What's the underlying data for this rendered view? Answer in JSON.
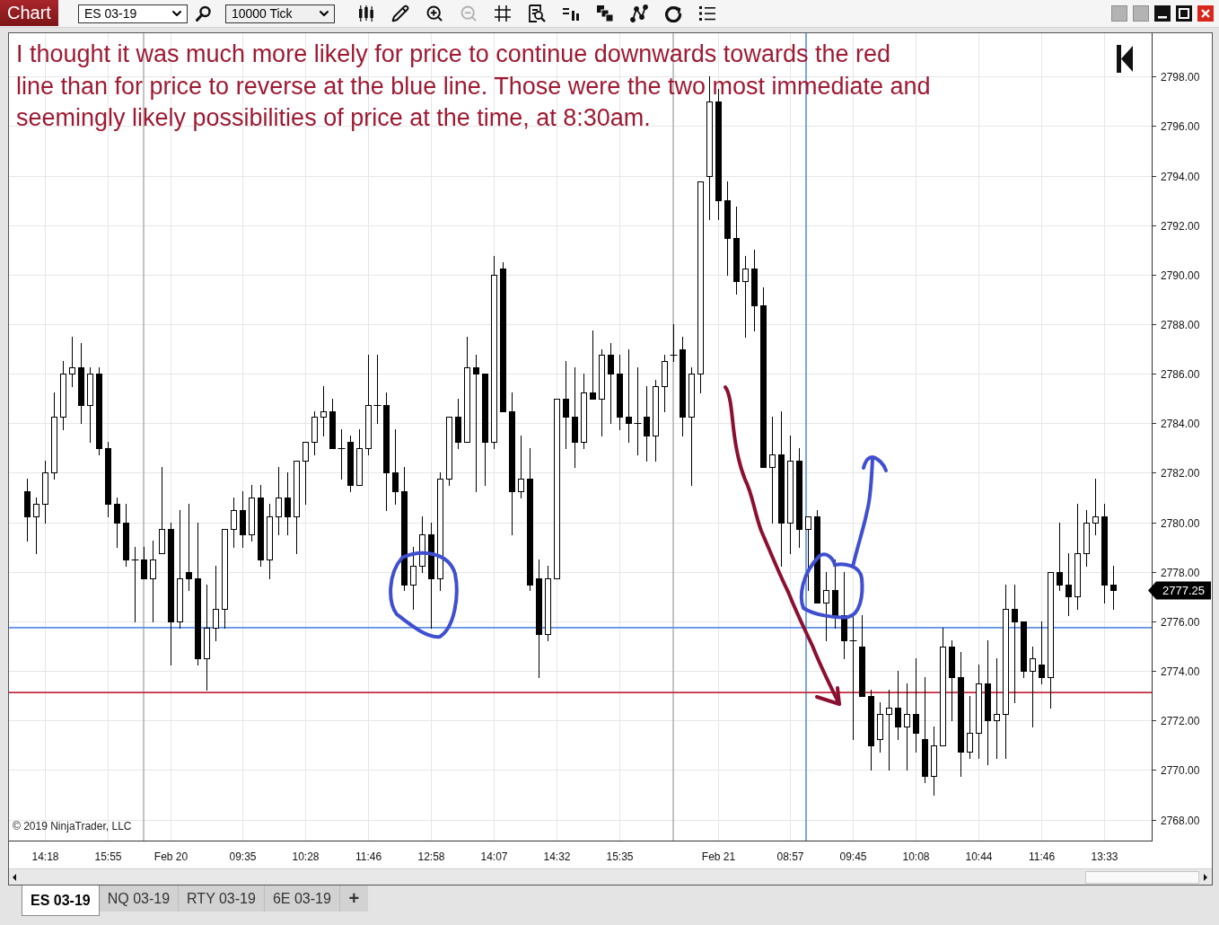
{
  "toolbar": {
    "title": "Chart",
    "instrument": "ES 03-19",
    "interval": "10000 Tick",
    "tools": [
      {
        "kind": "candles",
        "disabled": false
      },
      {
        "kind": "pencil",
        "disabled": false
      },
      {
        "kind": "zoomin",
        "disabled": false
      },
      {
        "kind": "zoomout",
        "disabled": true
      },
      {
        "kind": "crosshair",
        "disabled": false
      },
      {
        "kind": "databox",
        "disabled": false
      },
      {
        "kind": "strategy",
        "disabled": false
      },
      {
        "kind": "layers",
        "disabled": false
      },
      {
        "kind": "drawing",
        "disabled": false
      },
      {
        "kind": "reload",
        "disabled": false
      },
      {
        "kind": "list",
        "disabled": false
      }
    ]
  },
  "chart": {
    "chart_data": [
      {
        "type": "candlestick",
        "categories": [
          null,
          null,
          "14:18",
          null,
          null,
          null,
          null,
          null,
          null,
          "15:55",
          null,
          null,
          null,
          null,
          null,
          null,
          "Feb 20",
          null,
          null,
          null,
          null,
          null,
          null,
          null,
          "09:35",
          null,
          null,
          null,
          null,
          null,
          null,
          "10:28",
          null,
          null,
          null,
          null,
          null,
          null,
          "11:46",
          null,
          null,
          null,
          null,
          null,
          null,
          "12:58",
          null,
          null,
          null,
          null,
          null,
          null,
          "14:07",
          null,
          null,
          null,
          null,
          null,
          null,
          "14:32",
          null,
          null,
          null,
          null,
          null,
          null,
          "15:35",
          null,
          null,
          null,
          null,
          null,
          null,
          null,
          null,
          null,
          null,
          "Feb 21",
          null,
          null,
          null,
          null,
          null,
          null,
          null,
          "08:57",
          null,
          null,
          null,
          null,
          null,
          null,
          "09:45",
          null,
          null,
          null,
          null,
          null,
          null,
          "10:08",
          null,
          null,
          null,
          null,
          null,
          null,
          "10:44",
          null,
          null,
          null,
          null,
          null,
          null,
          "11:46",
          null,
          null,
          null,
          null,
          null,
          null,
          "13:33",
          null
        ],
        "ohlc": [
          [
            2781.25,
            2781.75,
            2779.25,
            2780.25
          ],
          [
            2780.25,
            2781,
            2778.75,
            2780.75
          ],
          [
            2780.75,
            2782.5,
            2780,
            2782
          ],
          [
            2782,
            2785.25,
            2781.75,
            2784.25
          ],
          [
            2784.25,
            2786.5,
            2783.75,
            2786
          ],
          [
            2786,
            2787.5,
            2785.5,
            2786.25
          ],
          [
            2786.25,
            2787.25,
            2784,
            2784.75
          ],
          [
            2784.75,
            2786.25,
            2783.25,
            2786
          ],
          [
            2786,
            2786.25,
            2782.75,
            2783
          ],
          [
            2783,
            2783.25,
            2780.25,
            2780.75
          ],
          [
            2780.75,
            2781,
            2779,
            2780
          ],
          [
            2780,
            2780.75,
            2778.25,
            2778.5
          ],
          [
            2778.5,
            2779,
            2776,
            2778.5
          ],
          [
            2778.5,
            2779,
            2777.75,
            2777.75
          ],
          [
            2777.75,
            2779.25,
            2776,
            2778.5
          ],
          [
            2778.75,
            2782.25,
            2778.75,
            2779.75
          ],
          [
            2779.75,
            2780,
            2774.25,
            2776
          ],
          [
            2776,
            2780.5,
            2775.75,
            2777.75
          ],
          [
            2778,
            2780.75,
            2777.25,
            2777.75
          ],
          [
            2777.75,
            2780,
            2774.25,
            2774.5
          ],
          [
            2774.5,
            2777.5,
            2773.25,
            2775.75
          ],
          [
            2775.75,
            2778.25,
            2775.25,
            2776.5
          ],
          [
            2776.5,
            2779.75,
            2775.75,
            2779.75
          ],
          [
            2779.75,
            2781,
            2779,
            2780.5
          ],
          [
            2780.5,
            2781.25,
            2779,
            2779.5
          ],
          [
            2779.5,
            2781.5,
            2779.25,
            2781
          ],
          [
            2781,
            2781.5,
            2778.25,
            2778.5
          ],
          [
            2778.5,
            2780.75,
            2777.75,
            2780.25
          ],
          [
            2780.25,
            2782.25,
            2779.5,
            2781
          ],
          [
            2781,
            2782,
            2779.5,
            2780.25
          ],
          [
            2780.25,
            2782.5,
            2778.75,
            2782.5
          ],
          [
            2782.5,
            2783.25,
            2780.75,
            2783.25
          ],
          [
            2783.25,
            2784.5,
            2782.75,
            2784.25
          ],
          [
            2784.25,
            2785.5,
            2783.5,
            2784.5
          ],
          [
            2784.5,
            2785,
            2783,
            2783
          ],
          [
            2783,
            2783.75,
            2781.75,
            2783
          ],
          [
            2783.25,
            2783.5,
            2781.25,
            2781.5
          ],
          [
            2781.5,
            2783.75,
            2781.5,
            2783
          ],
          [
            2783,
            2786.75,
            2782.75,
            2784.75
          ],
          [
            2784.75,
            2786.75,
            2784,
            2784.75
          ],
          [
            2784.75,
            2785.25,
            2780.5,
            2782
          ],
          [
            2782,
            2783.75,
            2780.75,
            2781.25
          ],
          [
            2781.25,
            2782.25,
            2777.25,
            2777.5
          ],
          [
            2777.5,
            2779,
            2776.5,
            2778.25
          ],
          [
            2778.25,
            2780.25,
            2778,
            2779.5
          ],
          [
            2779.5,
            2780,
            2775.75,
            2777.75
          ],
          [
            2777.75,
            2782,
            2777.25,
            2781.75
          ],
          [
            2781.75,
            2784.25,
            2781.5,
            2784.25
          ],
          [
            2784.25,
            2785,
            2783,
            2783.25
          ],
          [
            2783.25,
            2787.5,
            2783.25,
            2786.25
          ],
          [
            2786.25,
            2786.75,
            2781.25,
            2786
          ],
          [
            2786,
            2786,
            2781.5,
            2783.25
          ],
          [
            2783.25,
            2790.75,
            2783,
            2790
          ],
          [
            2790.25,
            2790.5,
            2784.5,
            2784.5
          ],
          [
            2784.5,
            2785.25,
            2779.5,
            2781.25
          ],
          [
            2781.25,
            2783.5,
            2781,
            2781.75
          ],
          [
            2781.75,
            2783,
            2777.25,
            2777.5
          ],
          [
            2777.75,
            2778.5,
            2773.75,
            2775.5
          ],
          [
            2775.5,
            2778.25,
            2775.25,
            2777.75
          ],
          [
            2777.75,
            2785,
            2777.75,
            2785
          ],
          [
            2785,
            2786.5,
            2783,
            2784.25
          ],
          [
            2784.25,
            2786.25,
            2782.25,
            2783.25
          ],
          [
            2783.25,
            2786,
            2783,
            2785.25
          ],
          [
            2785.25,
            2787.75,
            2785,
            2785
          ],
          [
            2785,
            2787,
            2783.5,
            2786.75
          ],
          [
            2786.75,
            2787.25,
            2784,
            2786
          ],
          [
            2786,
            2786.75,
            2783.75,
            2784.25
          ],
          [
            2784.25,
            2787,
            2783.25,
            2784
          ],
          [
            2784,
            2786.25,
            2782.75,
            2784
          ],
          [
            2784.25,
            2785.5,
            2782.5,
            2783.5
          ],
          [
            2783.5,
            2785.75,
            2782.5,
            2785.5
          ],
          [
            2785.5,
            2786.75,
            2784.5,
            2786.5
          ],
          [
            2786.75,
            2788,
            2786.5,
            2786.75
          ],
          [
            2787,
            2787.5,
            2783.5,
            2784.25
          ],
          [
            2784.25,
            2786.25,
            2781.5,
            2786
          ],
          [
            2786,
            2793.75,
            2785.25,
            2793.75
          ],
          [
            2794,
            2798,
            2792.25,
            2797
          ],
          [
            2797,
            2797.5,
            2792.25,
            2793
          ],
          [
            2793,
            2793.75,
            2790,
            2791.5
          ],
          [
            2791.5,
            2792.75,
            2789.25,
            2789.75
          ],
          [
            2789.75,
            2790.75,
            2787.5,
            2790.25
          ],
          [
            2790.25,
            2791,
            2787.75,
            2788.75
          ],
          [
            2788.75,
            2789.5,
            2782.25,
            2782.25
          ],
          [
            2782.25,
            2784.25,
            2780,
            2782.75
          ],
          [
            2782.75,
            2784.5,
            2778.25,
            2780
          ],
          [
            2780,
            2783.5,
            2778.75,
            2782.5
          ],
          [
            2782.5,
            2783,
            2779,
            2779.75
          ],
          [
            2779.75,
            2780.25,
            2777.25,
            2780.25
          ],
          [
            2780.25,
            2780.5,
            2776.75,
            2776.75
          ],
          [
            2776.75,
            2778,
            2775.25,
            2777.25
          ],
          [
            2777.25,
            2778.5,
            2775.75,
            2776.25
          ],
          [
            2776.25,
            2778,
            2774.5,
            2775.25
          ],
          [
            2775.25,
            2776.25,
            2771.25,
            2775.25
          ],
          [
            2775,
            2776.25,
            2773,
            2773
          ],
          [
            2773,
            2773.25,
            2770,
            2771
          ],
          [
            2771.25,
            2772.75,
            2770.75,
            2772.25
          ],
          [
            2772.25,
            2773.25,
            2770,
            2772.5
          ],
          [
            2772.5,
            2774,
            2771.25,
            2771.75
          ],
          [
            2771.75,
            2773.5,
            2770,
            2772.25
          ],
          [
            2772.25,
            2774.5,
            2770.75,
            2771.5
          ],
          [
            2771.25,
            2773.75,
            2769.5,
            2769.75
          ],
          [
            2769.75,
            2771.75,
            2769,
            2771
          ],
          [
            2771,
            2775.75,
            2771,
            2775
          ],
          [
            2775,
            2775.25,
            2772,
            2773.75
          ],
          [
            2773.75,
            2774.75,
            2769.75,
            2770.75
          ],
          [
            2770.75,
            2773,
            2770.5,
            2771.5
          ],
          [
            2771.5,
            2774.25,
            2770.5,
            2773.5
          ],
          [
            2773.5,
            2775.25,
            2770.25,
            2772
          ],
          [
            2772,
            2774.5,
            2770.5,
            2772.25
          ],
          [
            2772.25,
            2777.5,
            2770.5,
            2776.5
          ],
          [
            2776.5,
            2777.5,
            2772.75,
            2776
          ],
          [
            2776,
            2776,
            2773.75,
            2774
          ],
          [
            2774,
            2775,
            2771.75,
            2774.5
          ],
          [
            2774.25,
            2776,
            2773.5,
            2773.75
          ],
          [
            2773.75,
            2778,
            2772.5,
            2778
          ],
          [
            2778,
            2780,
            2777.25,
            2777.5
          ],
          [
            2777.5,
            2778.75,
            2776.25,
            2777
          ],
          [
            2777,
            2780.75,
            2776.5,
            2778.75
          ],
          [
            2778.75,
            2780.5,
            2778.25,
            2780
          ],
          [
            2780,
            2781.75,
            2779.5,
            2780.25
          ],
          [
            2780.25,
            2780.75,
            2776.75,
            2777.5
          ],
          [
            2777.5,
            2778.25,
            2776.5,
            2777.25
          ]
        ],
        "ylim": [
          2767.15,
          2799.75
        ],
        "yticks": [
          {
            "value": 2798,
            "label": "2798.00"
          },
          {
            "value": 2796,
            "label": "2796.00"
          },
          {
            "value": 2794,
            "label": "2794.00"
          },
          {
            "value": 2792,
            "label": "2792.00"
          },
          {
            "value": 2790,
            "label": "2790.00"
          },
          {
            "value": 2788,
            "label": "2788.00"
          },
          {
            "value": 2786,
            "label": "2786.00"
          },
          {
            "value": 2784,
            "label": "2784.00"
          },
          {
            "value": 2782,
            "label": "2782.00"
          },
          {
            "value": 2780,
            "label": "2780.00"
          },
          {
            "value": 2778,
            "label": "2778.00"
          },
          {
            "value": 2776,
            "label": "2776.00"
          },
          {
            "value": 2774,
            "label": "2774.00"
          },
          {
            "value": 2772,
            "label": "2772.00"
          },
          {
            "value": 2770,
            "label": "2770.00"
          },
          {
            "value": 2768,
            "label": "2768.00"
          }
        ],
        "grid": true,
        "ref_lines": [
          {
            "axis": "y",
            "value": 2775.75,
            "color": "#5b8fe6"
          },
          {
            "axis": "y",
            "value": 2773.13,
            "color": "#c42a40"
          }
        ],
        "annotations": [
          "I thought it was much more likely for price to continue downwards towards the red line than for price to reverse at the blue line. Those were the two most immediate and seemingly likely possibilities of price at the time, at 8:30am."
        ]
      }
    ],
    "last_price": "2777.25",
    "copyright": "© 2019 NinjaTrader, LLC"
  },
  "tabs": [
    {
      "label": "ES 03-19",
      "selected": true
    },
    {
      "label": "NQ 03-19",
      "selected": false
    },
    {
      "label": "RTY 03-19",
      "selected": false
    },
    {
      "label": "6E 03-19",
      "selected": false
    }
  ],
  "add_tab": "+"
}
